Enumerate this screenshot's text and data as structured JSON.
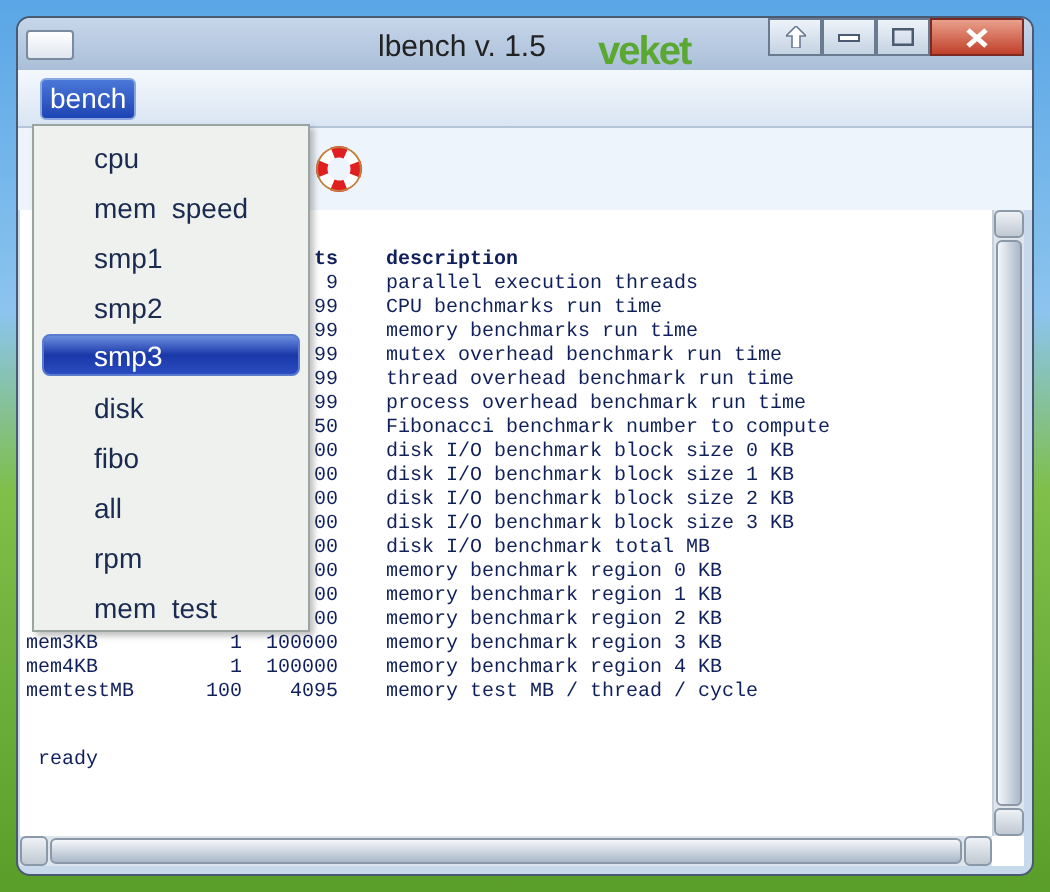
{
  "window": {
    "title": "lbench v. 1.5",
    "logo": "veket"
  },
  "menu_bar": [
    {
      "label": "bench",
      "selected": true
    }
  ],
  "menu": [
    {
      "label": "cpu",
      "selected": false
    },
    {
      "label": "mem  speed",
      "selected": false
    },
    {
      "label": "smp1",
      "selected": false
    },
    {
      "label": "smp2",
      "selected": false
    },
    {
      "label": "smp3",
      "selected": true
    },
    {
      "label": "disk",
      "selected": false
    },
    {
      "label": "fibo",
      "selected": false
    },
    {
      "label": "all",
      "selected": false
    },
    {
      "label": "rpm",
      "selected": false
    },
    {
      "label": "mem  test",
      "selected": false
    }
  ],
  "output": {
    "header": {
      "column_3": "ts",
      "description": "description"
    },
    "rows": [
      {
        "column_3": "9",
        "description": "parallel execution threads"
      },
      {
        "column_3": "99",
        "description": "CPU benchmarks run time"
      },
      {
        "column_3": "99",
        "description": "memory benchmarks run time"
      },
      {
        "column_3": "99",
        "description": "mutex overhead benchmark run time"
      },
      {
        "column_3": "99",
        "description": "thread overhead benchmark run time"
      },
      {
        "column_3": "99",
        "description": "process overhead benchmark run time"
      },
      {
        "column_3": "50",
        "description": "Fibonacci benchmark number to compute"
      },
      {
        "column_3": "00",
        "description": "disk I/O benchmark block size 0 KB"
      },
      {
        "column_3": "00",
        "description": "disk I/O benchmark block size 1 KB"
      },
      {
        "column_3": "00",
        "description": "disk I/O benchmark block size 2 KB"
      },
      {
        "column_3": "00",
        "description": "disk I/O benchmark block size 3 KB"
      },
      {
        "column_3": "00",
        "description": "disk I/O benchmark total MB"
      },
      {
        "column_3": "00",
        "description": "memory benchmark region 0 KB"
      },
      {
        "column_3": "00",
        "description": "memory benchmark region 1 KB"
      },
      {
        "column_3": "00",
        "description": "memory benchmark region 2 KB"
      },
      {
        "column_1": "mem3KB",
        "column_2": "1",
        "column_3": "100000",
        "description": "memory benchmark region 3 KB"
      },
      {
        "column_1": "mem4KB",
        "column_2": "1",
        "column_3": "100000",
        "description": "memory benchmark region 4 KB"
      },
      {
        "column_1": "memtestMB",
        "column_2": "100",
        "column_3": "4095",
        "description": "memory test MB / thread / cycle"
      }
    ],
    "status": "ready"
  }
}
